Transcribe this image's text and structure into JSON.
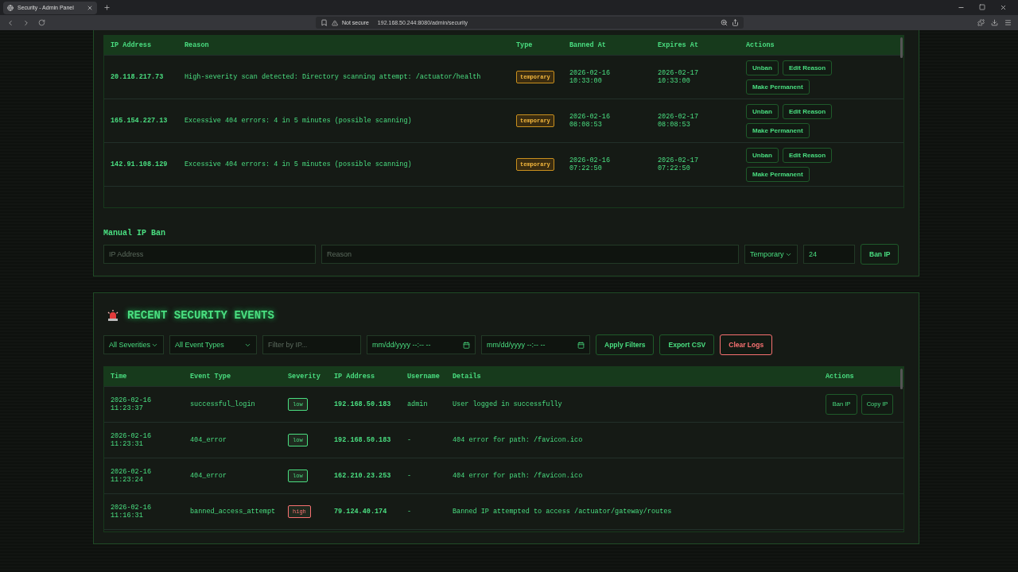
{
  "browser": {
    "tab_title": "Security - Admin Panel",
    "url_warning": "Not secure",
    "url": "192.168.50.244:8080/admin/security"
  },
  "banned_ips": {
    "columns": [
      "IP Address",
      "Reason",
      "Type",
      "Banned At",
      "Expires At",
      "Actions"
    ],
    "rows": [
      {
        "ip": "20.118.217.73",
        "reason": "High-severity scan detected: Directory scanning attempt: /actuator/health",
        "type": "temporary",
        "banned_at": [
          "2026-02-16",
          "10:33:00"
        ],
        "expires_at": [
          "2026-02-17",
          "10:33:00"
        ],
        "actions": [
          "Unban",
          "Edit Reason",
          "Make Permanent"
        ]
      },
      {
        "ip": "165.154.227.13",
        "reason": "Excessive 404 errors: 4 in 5 minutes (possible scanning)",
        "type": "temporary",
        "banned_at": [
          "2026-02-16",
          "08:08:53"
        ],
        "expires_at": [
          "2026-02-17",
          "08:08:53"
        ],
        "actions": [
          "Unban",
          "Edit Reason",
          "Make Permanent"
        ]
      },
      {
        "ip": "142.91.108.129",
        "reason": "Excessive 404 errors: 4 in 5 minutes (possible scanning)",
        "type": "temporary",
        "banned_at": [
          "2026-02-16",
          "07:22:50"
        ],
        "expires_at": [
          "2026-02-17",
          "07:22:50"
        ],
        "actions": [
          "Unban",
          "Edit Reason",
          "Make Permanent"
        ]
      }
    ]
  },
  "manual_ban": {
    "title": "Manual IP Ban",
    "ip_placeholder": "IP Address",
    "reason_placeholder": "Reason",
    "ban_type": "Temporary",
    "hours": "24",
    "button": "Ban IP"
  },
  "events": {
    "title": "RECENT SECURITY EVENTS",
    "filters": {
      "severity": "All Severities",
      "event_type": "All Event Types",
      "ip_placeholder": "Filter by IP...",
      "from": "mm/dd/yyyy --:-- --",
      "to": "mm/dd/yyyy --:-- --"
    },
    "buttons": [
      {
        "label": "Apply Filters",
        "kind": "normal"
      },
      {
        "label": "Export CSV",
        "kind": "normal"
      },
      {
        "label": "Clear Logs",
        "kind": "danger"
      }
    ],
    "columns": [
      "Time",
      "Event Type",
      "Severity",
      "IP Address",
      "Username",
      "Details",
      "Actions"
    ],
    "rows": [
      {
        "time": [
          "2026-02-16",
          "11:23:37"
        ],
        "event_type": "successful_login",
        "severity": "low",
        "color": "#4ade80",
        "ip": "192.168.50.183",
        "username": "admin",
        "details": "User logged in successfully",
        "actions": [
          "Ban IP",
          "Copy IP"
        ]
      },
      {
        "time": [
          "2026-02-16",
          "11:23:31"
        ],
        "event_type": "404_error",
        "severity": "low",
        "color": "#4ade80",
        "ip": "192.168.50.183",
        "username": "-",
        "details": "404 error for path: /favicon.ico"
      },
      {
        "time": [
          "2026-02-16",
          "11:23:24"
        ],
        "event_type": "404_error",
        "severity": "low",
        "color": "#4ade80",
        "ip": "162.210.23.253",
        "username": "-",
        "details": "404 error for path: /favicon.ico"
      },
      {
        "time": [
          "2026-02-16",
          "11:16:31"
        ],
        "event_type": "banned_access_attempt",
        "severity": "high",
        "color": "#f87171",
        "ip": "79.124.40.174",
        "username": "-",
        "details": "Banned IP attempted to access /actuator/gateway/routes"
      }
    ]
  }
}
